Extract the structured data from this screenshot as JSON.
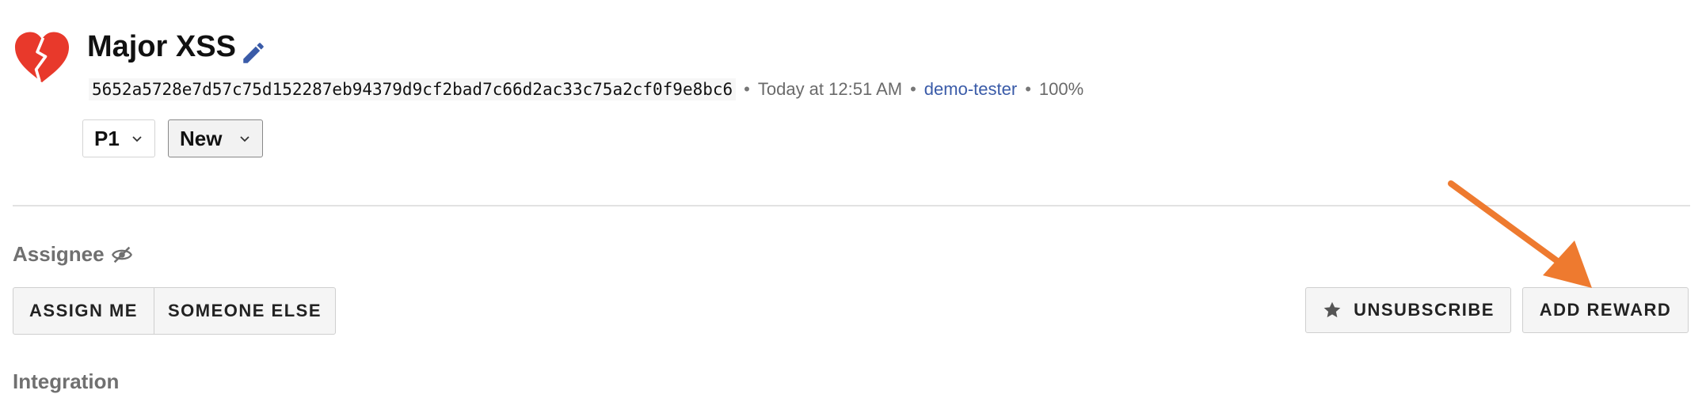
{
  "header": {
    "title": "Major XSS",
    "icon": "broken-heart-icon",
    "edit_icon": "pencil-icon"
  },
  "meta": {
    "hash": "5652a5728e7d57c75d152287eb94379d9cf2bad7c66d2ac33c75a2cf0f9e8bc6",
    "separator": "•",
    "timestamp": "Today at 12:51 AM",
    "user": "demo-tester",
    "percent": "100%"
  },
  "selects": {
    "priority": "P1",
    "status": "New"
  },
  "assignee": {
    "label": "Assignee",
    "icon": "eye-off-icon",
    "assign_me": "ASSIGN ME",
    "someone_else": "SOMEONE ELSE"
  },
  "actions": {
    "unsubscribe": "UNSUBSCRIBE",
    "unsubscribe_icon": "star-icon",
    "add_reward": "ADD REWARD"
  },
  "annotation": {
    "arrow_color": "#ee7a2f"
  },
  "colors": {
    "brand_red": "#e8392b",
    "link_blue": "#3a5ba8"
  },
  "footer": {
    "cut_text": "Integration"
  }
}
